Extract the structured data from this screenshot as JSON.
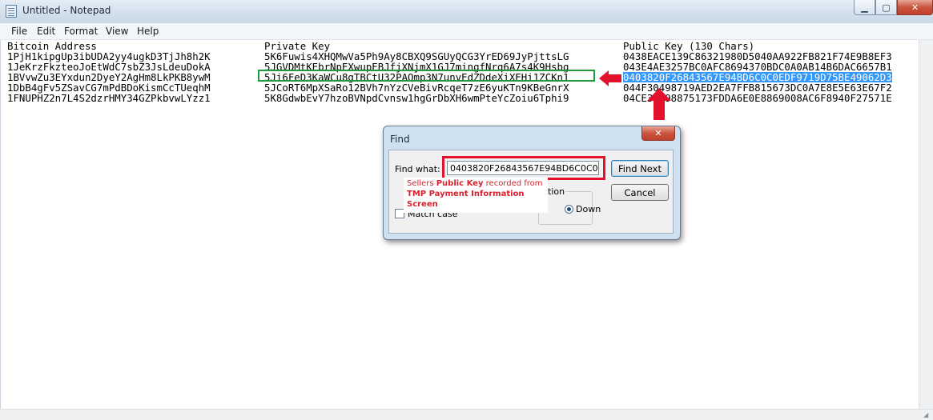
{
  "window": {
    "title": "Untitled - Notepad"
  },
  "menu": [
    {
      "label": "File"
    },
    {
      "label": "Edit"
    },
    {
      "label": "Format"
    },
    {
      "label": "View"
    },
    {
      "label": "Help"
    }
  ],
  "document": {
    "headers": [
      "Bitcoin Address",
      "Private Key",
      "Public Key (130 Chars)"
    ],
    "rows": [
      [
        "1PjH1kipgUp3ibUDA2yy4ugkD3TjJh8h2K",
        "5K6Fuwis4XHQMwVa5Ph9Ay8CBXQ9SGUyQCG3YrED69JyPjttsLG",
        "0438EACE139C86321980D5040AA922FB821F74E9B8EF3"
      ],
      [
        "1JeKrzFkzteoJoEtWdC7sbZ3JsLdeuDokA",
        "5JGVDMtKEbrNpEXwupEBJfjXNjmX1GJ7mingfNrq6A7s4K9Hsbg",
        "043E4AE3257BC0AFC8694370BDC0A0AB14B6DAC6657B1"
      ],
      [
        "1BVvwZu3EYxdun2DyeY2AgHm8LkPKB8ywM",
        "5Ji6FeD3KaWCu8gTBCtU32PAQmp3N7unvEdZDdeXiXEHi1ZCKn1",
        "0403820F26843567E94BD6C0C0EDF9719D75BE49062D3"
      ],
      [
        "1DbB4gFv5ZSavCG7mPdBDoKismCcTUeqhM",
        "5JCoRT6MpXSaRo12BVh7nYzCVeBivRcqeT7zE6yuKTn9KBeGnrX",
        "044F30498719AED2EA7FFB815673DC0A7E8E5E63E67F2"
      ],
      [
        "1FNUPHZ2n7L4S2dzrHMY34GZPkbvwLYzz1",
        "5K8GdwbEvY7hzoBVNpdCvnsw1hgGrDbXH6wmPteYcZoiu6Tphi9",
        "04CE3C598875173FDDA6E0E8869008AC6F8940F27571E"
      ]
    ]
  },
  "find_dialog": {
    "title": "Find",
    "find_what_label": "Find what:",
    "find_what_value": "0403820F26843567E94BD6C0C0EDF",
    "find_next_label": "Find Next",
    "cancel_label": "Cancel",
    "direction_label": "tion",
    "down_label": "Down",
    "match_case_label": "Match case"
  },
  "annotation": {
    "line1_prefix": "Sellers ",
    "line1_bold": "Public Key",
    "line1_suffix": " recorded from",
    "line2": "TMP Payment Information",
    "line3": "Screen"
  },
  "colors": {
    "selection": "#3399ff",
    "highlight_box": "#1f9a3e",
    "annotation_red": "#e3112c"
  }
}
